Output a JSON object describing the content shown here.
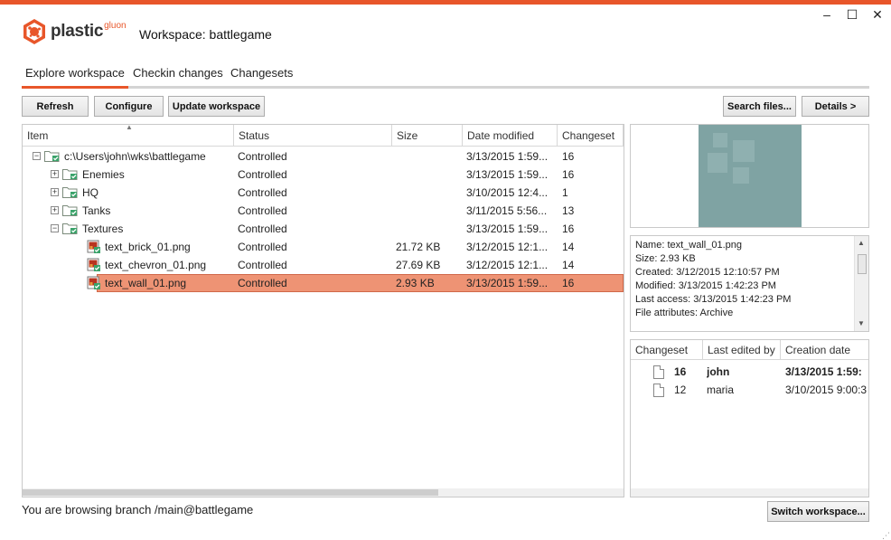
{
  "window": {
    "minimize": "–",
    "maximize": "☐",
    "close": "✕"
  },
  "brand": {
    "name": "plastic",
    "suffix": "gluon",
    "accent": "#e8562a"
  },
  "workspace": {
    "title": "Workspace: battlegame"
  },
  "tabs": [
    {
      "label": "Explore workspace",
      "active": true
    },
    {
      "label": "Checkin changes",
      "active": false
    },
    {
      "label": "Changesets",
      "active": false
    }
  ],
  "toolbar": {
    "refresh_label": "Refresh",
    "configure_label": "Configure",
    "update_label": "Update workspace",
    "search_label": "Search files...",
    "details_label": "Details >"
  },
  "file_table": {
    "columns": [
      "Item",
      "Status",
      "Size",
      "Date modified",
      "Changeset"
    ],
    "rows": [
      {
        "item": "c:\\Users\\john\\wks\\battlegame",
        "status": "Controlled",
        "size": "",
        "date": "3/13/2015 1:59...",
        "changeset": "16",
        "type": "folder",
        "expander": "−"
      },
      {
        "item": "Enemies",
        "status": "Controlled",
        "size": "",
        "date": "3/13/2015 1:59...",
        "changeset": "16",
        "type": "folder",
        "expander": "+"
      },
      {
        "item": "HQ",
        "status": "Controlled",
        "size": "",
        "date": "3/10/2015 12:4...",
        "changeset": "1",
        "type": "folder",
        "expander": "+"
      },
      {
        "item": "Tanks",
        "status": "Controlled",
        "size": "",
        "date": "3/11/2015 5:56...",
        "changeset": "13",
        "type": "folder",
        "expander": "+"
      },
      {
        "item": "Textures",
        "status": "Controlled",
        "size": "",
        "date": "3/13/2015 1:59...",
        "changeset": "16",
        "type": "folder",
        "expander": "−"
      },
      {
        "item": "text_brick_01.png",
        "status": "Controlled",
        "size": "21.72 KB",
        "date": "3/12/2015 12:1...",
        "changeset": "14",
        "type": "file",
        "expander": ""
      },
      {
        "item": "text_chevron_01.png",
        "status": "Controlled",
        "size": "27.69 KB",
        "date": "3/12/2015 12:1...",
        "changeset": "14",
        "type": "file",
        "expander": ""
      },
      {
        "item": "text_wall_01.png",
        "status": "Controlled",
        "size": "2.93 KB",
        "date": "3/13/2015 1:59...",
        "changeset": "16",
        "type": "file",
        "expander": "",
        "selected": true
      }
    ]
  },
  "details": {
    "lines": [
      "Name: text_wall_01.png",
      "Size: 2.93 KB",
      "Created: 3/12/2015 12:10:57 PM",
      "Modified: 3/13/2015 1:42:23 PM",
      "Last access: 3/13/2015 1:42:23 PM",
      "File attributes: Archive"
    ]
  },
  "history": {
    "columns": [
      "Changeset",
      "Last edited by",
      "Creation date"
    ],
    "rows": [
      {
        "changeset": "16",
        "user": "john",
        "date": "3/13/2015 1:59:",
        "bold": true
      },
      {
        "changeset": "12",
        "user": "maria",
        "date": "3/10/2015 9:00:3",
        "bold": false
      }
    ]
  },
  "footer": {
    "status": "You are browsing branch /main@battlegame",
    "switch_label": "Switch workspace..."
  },
  "colors": {
    "selection": "#ee9374",
    "preview_bg": "#7fa3a3",
    "folder_green": "#3aa36a"
  }
}
